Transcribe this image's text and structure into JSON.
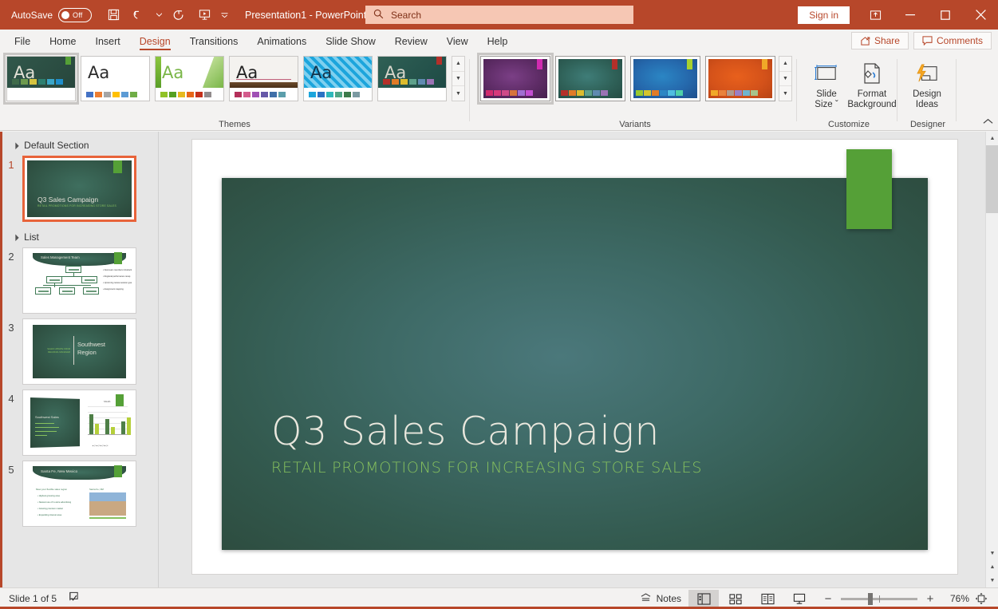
{
  "titlebar": {
    "autosave_label": "AutoSave",
    "autosave_state": "Off",
    "document_title": "Presentation1  -  PowerPoint",
    "signin_label": "Sign in",
    "qat": [
      {
        "name": "save-icon",
        "tooltip": "Save"
      },
      {
        "name": "undo-icon",
        "tooltip": "Undo"
      },
      {
        "name": "redo-icon",
        "tooltip": "Redo"
      },
      {
        "name": "start-slideshow-icon",
        "tooltip": "Start From Beginning"
      },
      {
        "name": "customize-qat-icon",
        "tooltip": "Customize Quick Access Toolbar"
      }
    ],
    "window_buttons": [
      "ribbon-display-options",
      "minimize",
      "maximize",
      "close"
    ],
    "accent_color": "#b7472a"
  },
  "search": {
    "placeholder": "Search",
    "icon": "search-icon"
  },
  "tabs": [
    {
      "label": "File",
      "active": false
    },
    {
      "label": "Home",
      "active": false
    },
    {
      "label": "Insert",
      "active": false
    },
    {
      "label": "Design",
      "active": true
    },
    {
      "label": "Transitions",
      "active": false
    },
    {
      "label": "Animations",
      "active": false
    },
    {
      "label": "Slide Show",
      "active": false
    },
    {
      "label": "Review",
      "active": false
    },
    {
      "label": "View",
      "active": false
    },
    {
      "label": "Help",
      "active": false
    }
  ],
  "tab_actions": {
    "share_label": "Share",
    "comments_label": "Comments"
  },
  "ribbon": {
    "groups": [
      {
        "name": "themes",
        "label": "Themes"
      },
      {
        "name": "variants",
        "label": "Variants"
      },
      {
        "name": "customize",
        "label": "Customize"
      },
      {
        "name": "designer",
        "label": "Designer"
      }
    ],
    "themes": [
      {
        "name": "theme-green-chalkboard",
        "aa": "Aa",
        "selected": true,
        "bg": "linear-gradient(135deg,#31584b,#27463c)",
        "aa_color": "#e3e1d6",
        "swatches": [
          "#3f6b4b",
          "#6d9a4e",
          "#d5c33f",
          "#2d7f6f",
          "#3aa6c8",
          "#1f8ecb"
        ],
        "accent_tab": "#55a037"
      },
      {
        "name": "theme-office",
        "aa": "Aa",
        "selected": false,
        "bg": "#ffffff",
        "aa_color": "#2b2b2b",
        "swatches": [
          "#4472c4",
          "#ed7d31",
          "#a5a5a5",
          "#ffc000",
          "#5b9bd5",
          "#70ad47"
        ],
        "accent_tab": ""
      },
      {
        "name": "theme-facet",
        "aa": "Aa",
        "selected": false,
        "bg": "#ffffff",
        "aa_color": "#7ab648",
        "swatches": [
          "#90c226",
          "#54a021",
          "#e6b91e",
          "#e76618",
          "#c42f1a",
          "#918b8c"
        ],
        "accent_tab": ""
      },
      {
        "name": "theme-badge",
        "aa": "Aa",
        "selected": false,
        "bg": "#f4f2ef",
        "aa_color": "#222222",
        "swatches": [
          "#b4305a",
          "#d45b8c",
          "#a050b4",
          "#6659a8",
          "#3f6fa8",
          "#5b9eab"
        ],
        "accent_tab": ""
      },
      {
        "name": "theme-berlin",
        "aa": "Aa",
        "selected": false,
        "bg": "#2b9fd4",
        "aa_color": "#12334a",
        "swatches": [
          "#1ca5dc",
          "#2a72c4",
          "#2fb8bb",
          "#4fa585",
          "#3c7a4a",
          "#7b9aa1"
        ],
        "accent_tab": ""
      },
      {
        "name": "theme-dividend",
        "aa": "Aa",
        "selected": false,
        "bg": "linear-gradient(135deg,#2f6055,#1e4a45)",
        "aa_color": "#d8d6cb",
        "swatches": [
          "#b4302a",
          "#e07b28",
          "#ddbc2e",
          "#5da08a",
          "#5f8ab0",
          "#9a73b4"
        ],
        "accent_tab": "#b4302a"
      }
    ],
    "variants": [
      {
        "name": "variant-purple",
        "selected": true,
        "bg": "radial-gradient(ellipse at 45% 45%,#7b3f86 0%,#5e2c66 55%,#46204e 100%)",
        "accent_tab": "#d12bb0",
        "swatches": [
          "#d12b6e",
          "#d6397b",
          "#cf4a89",
          "#d6743c",
          "#a06fd1",
          "#c34fd1"
        ]
      },
      {
        "name": "variant-green",
        "selected": false,
        "bg": "radial-gradient(ellipse at 45% 45%,#3f7d78 0%,#2f6158 55%,#254c44 100%)",
        "accent_tab": "#b4302a",
        "swatches": [
          "#b4302a",
          "#e07b28",
          "#ddbc2e",
          "#5da08a",
          "#5f8ab0",
          "#9a73b4"
        ]
      },
      {
        "name": "variant-blue",
        "selected": false,
        "bg": "radial-gradient(ellipse at 45% 45%,#2b86c4 0%,#2568ac 55%,#1e4f8c 100%)",
        "accent_tab": "#a8d02e",
        "swatches": [
          "#9ac92e",
          "#d4c42e",
          "#e07b28",
          "#2b86c4",
          "#4fbde0",
          "#4fd0a8"
        ]
      },
      {
        "name": "variant-orange",
        "selected": false,
        "bg": "radial-gradient(ellipse at 45% 45%,#e8601c 0%,#d4521a 55%,#b84314 100%)",
        "accent_tab": "#f0a828",
        "swatches": [
          "#f0a828",
          "#e8823c",
          "#b09a8c",
          "#9a7fc4",
          "#6fb4cf",
          "#a8c48a"
        ]
      }
    ],
    "customize_buttons": [
      {
        "name": "slide-size-button",
        "line1": "Slide",
        "line2": "Size ˇ",
        "icon": "slide-size-icon"
      },
      {
        "name": "format-background-button",
        "line1": "Format",
        "line2": "Background",
        "icon": "format-background-icon"
      }
    ],
    "designer_buttons": [
      {
        "name": "design-ideas-button",
        "line1": "Design",
        "line2": "Ideas",
        "icon": "design-ideas-icon"
      }
    ],
    "collapse_icon": "chevron-up-icon"
  },
  "slide_panel": {
    "sections": [
      {
        "name": "Default Section",
        "collapsed": false
      },
      {
        "name": "List",
        "collapsed": false
      }
    ],
    "slides": [
      {
        "number": "1",
        "selected": true,
        "section": 0,
        "title": "Q3 Sales Campaign",
        "subtitle": "RETAIL PROMOTIONS FOR INCREASING STORE SALES",
        "layout": "title"
      },
      {
        "number": "2",
        "selected": false,
        "section": 1,
        "title": "Sales Management Team",
        "layout": "orgchart",
        "bullets": [
          "New team members introduction",
          "Regional performance recap",
          "Upcoming review session goals",
          "Assignment mapping"
        ]
      },
      {
        "number": "3",
        "selected": false,
        "section": 1,
        "title": "Southwest Region",
        "subtitle": "SALES UPDATE FROM\nREGIONAL MANAGER",
        "layout": "section"
      },
      {
        "number": "4",
        "selected": false,
        "section": 1,
        "title": "Southwest Sales",
        "layout": "chart"
      },
      {
        "number": "5",
        "selected": false,
        "section": 1,
        "title": "Santa Fe, New Mexico",
        "layout": "picture",
        "heading": "Meet your flexible sales region",
        "photo_caption": "Santa Fe, NM",
        "bullets": [
          "Highest grossing area",
          "Newest use of in-store advertising",
          "Growing premium market",
          "Expanding interest area"
        ]
      }
    ]
  },
  "main_slide": {
    "title": "Q3 Sales Campaign",
    "subtitle": "RETAIL PROMOTIONS FOR INCREASING STORE SALES",
    "title_color": "#e9e7dd",
    "subtitle_color": "#86c15e",
    "accent_rect_color": "#55a037",
    "bg_colors": [
      "#4b787b",
      "#2b4739"
    ]
  },
  "statusbar": {
    "slide_counter": "Slide 1 of 5",
    "accessibility_icon": "spellcheck-icon",
    "notes_label": "Notes",
    "notes_icon": "notes-icon",
    "views": [
      {
        "name": "normal-view-button",
        "icon": "normal-view-icon",
        "active": true
      },
      {
        "name": "slide-sorter-button",
        "icon": "slide-sorter-icon",
        "active": false
      },
      {
        "name": "reading-view-button",
        "icon": "reading-view-icon",
        "active": false
      },
      {
        "name": "slideshow-button",
        "icon": "slideshow-icon",
        "active": false
      }
    ],
    "zoom_out": "−",
    "zoom_in": "+",
    "zoom_level": "76%",
    "fit_icon": "fit-to-window-icon"
  }
}
